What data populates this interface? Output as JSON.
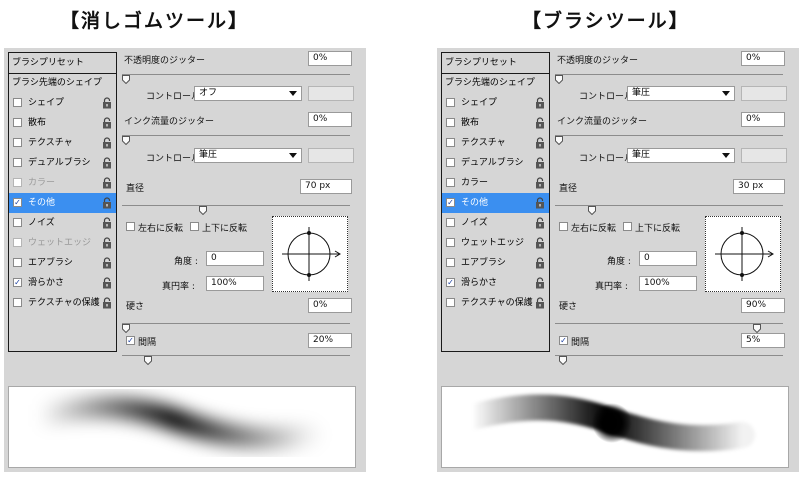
{
  "panels": [
    {
      "title": "【消しゴムツール】",
      "sidebar": {
        "header": "ブラシプリセット",
        "subheader": "ブラシ先端のシェイプ",
        "items": [
          {
            "label": "シェイプ",
            "checked": false,
            "disabled": false,
            "selected": false
          },
          {
            "label": "散布",
            "checked": false,
            "disabled": false,
            "selected": false
          },
          {
            "label": "テクスチャ",
            "checked": false,
            "disabled": false,
            "selected": false
          },
          {
            "label": "デュアルブラシ",
            "checked": false,
            "disabled": false,
            "selected": false
          },
          {
            "label": "カラー",
            "checked": false,
            "disabled": true,
            "selected": false
          },
          {
            "label": "その他",
            "checked": true,
            "disabled": false,
            "selected": true
          },
          {
            "label": "ノイズ",
            "checked": false,
            "disabled": false,
            "selected": false
          },
          {
            "label": "ウェットエッジ",
            "checked": false,
            "disabled": true,
            "selected": false
          },
          {
            "label": "エアブラシ",
            "checked": false,
            "disabled": false,
            "selected": false
          },
          {
            "label": "滑らかさ",
            "checked": true,
            "disabled": false,
            "selected": false
          },
          {
            "label": "テクスチャの保護",
            "checked": false,
            "disabled": false,
            "selected": false
          }
        ]
      },
      "opacity_jitter": {
        "label": "不透明度のジッター",
        "value": "0%",
        "level": 0
      },
      "control1": {
        "label": "コントロール :",
        "value": "オフ"
      },
      "flow_jitter": {
        "label": "インク流量のジッター",
        "value": "0%",
        "level": 0
      },
      "control2": {
        "label": "コントロール :",
        "value": "筆圧"
      },
      "diameter": {
        "label": "直径",
        "value": "70 px",
        "level": 0.35
      },
      "flip_x": {
        "label": "左右に反転",
        "checked": false
      },
      "flip_y": {
        "label": "上下に反転",
        "checked": false
      },
      "angle": {
        "label": "角度 :",
        "value": "0"
      },
      "roundness": {
        "label": "真円率 :",
        "value": "100%"
      },
      "hardness": {
        "label": "硬さ",
        "value": "0%",
        "level": 0
      },
      "spacing": {
        "label": "間隔",
        "checked": true,
        "value": "20%",
        "level": 0.1
      },
      "stroke_hardness": 0
    },
    {
      "title": "【ブラシツール】",
      "sidebar": {
        "header": "ブラシプリセット",
        "subheader": "ブラシ先端のシェイプ",
        "items": [
          {
            "label": "シェイプ",
            "checked": false,
            "disabled": false,
            "selected": false
          },
          {
            "label": "散布",
            "checked": false,
            "disabled": false,
            "selected": false
          },
          {
            "label": "テクスチャ",
            "checked": false,
            "disabled": false,
            "selected": false
          },
          {
            "label": "デュアルブラシ",
            "checked": false,
            "disabled": false,
            "selected": false
          },
          {
            "label": "カラー",
            "checked": false,
            "disabled": false,
            "selected": false
          },
          {
            "label": "その他",
            "checked": true,
            "disabled": false,
            "selected": true
          },
          {
            "label": "ノイズ",
            "checked": false,
            "disabled": false,
            "selected": false
          },
          {
            "label": "ウェットエッジ",
            "checked": false,
            "disabled": false,
            "selected": false
          },
          {
            "label": "エアブラシ",
            "checked": false,
            "disabled": false,
            "selected": false
          },
          {
            "label": "滑らかさ",
            "checked": true,
            "disabled": false,
            "selected": false
          },
          {
            "label": "テクスチャの保護",
            "checked": false,
            "disabled": false,
            "selected": false
          }
        ]
      },
      "opacity_jitter": {
        "label": "不透明度のジッター",
        "value": "0%",
        "level": 0
      },
      "control1": {
        "label": "コントロール :",
        "value": "筆圧"
      },
      "flow_jitter": {
        "label": "インク流量のジッター",
        "value": "0%",
        "level": 0
      },
      "control2": {
        "label": "コントロール :",
        "value": "筆圧"
      },
      "diameter": {
        "label": "直径",
        "value": "30 px",
        "level": 0.15
      },
      "flip_x": {
        "label": "左右に反転",
        "checked": false
      },
      "flip_y": {
        "label": "上下に反転",
        "checked": false
      },
      "angle": {
        "label": "角度 :",
        "value": "0"
      },
      "roundness": {
        "label": "真円率 :",
        "value": "100%"
      },
      "hardness": {
        "label": "硬さ",
        "value": "90%",
        "level": 0.9
      },
      "spacing": {
        "label": "間隔",
        "checked": true,
        "value": "5%",
        "level": 0.02
      },
      "stroke_hardness": 0.9
    }
  ],
  "colors": {
    "panel_bg": "#d6d6d6",
    "selected_bg": "#3b8ff0",
    "border": "#1a1a1a"
  }
}
